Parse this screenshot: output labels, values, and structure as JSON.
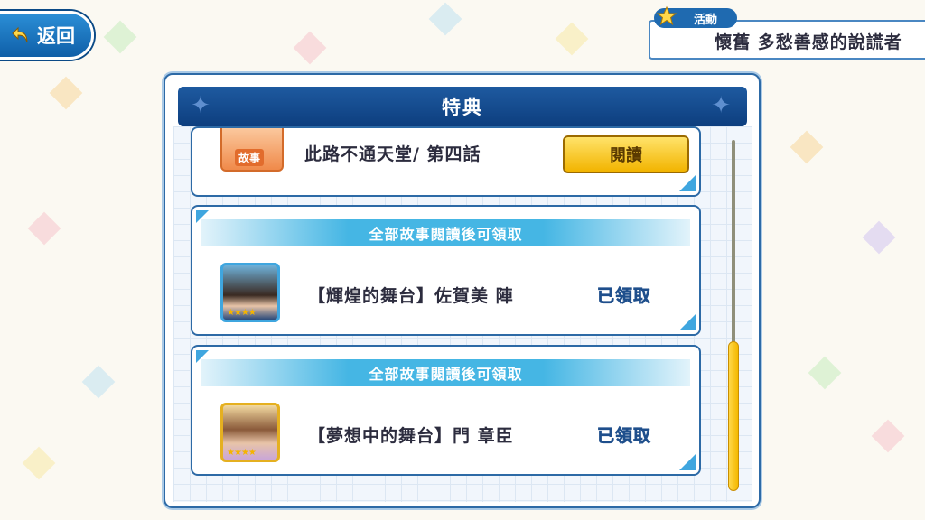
{
  "back_button": {
    "label": "返回",
    "icon": "back-arrow-icon"
  },
  "event": {
    "tag": "活動",
    "title": "懷舊 多愁善感的說謊者"
  },
  "panel": {
    "title": "特典",
    "story_item": {
      "icon_label": "故事",
      "title": "此路不通天堂/ 第四話",
      "button_label": "閱讀"
    },
    "rewards": [
      {
        "banner": "全部故事閱讀後可領取",
        "name": "【輝煌的舞台】佐賀美 陣",
        "status": "已領取",
        "stars": "★★★★"
      },
      {
        "banner": "全部故事閱讀後可領取",
        "name": "【夢想中的舞台】門 章臣",
        "status": "已領取",
        "stars": "★★★★"
      }
    ]
  },
  "colors": {
    "primary": "#1e5aa0",
    "accent": "#45b6e4",
    "button": "#f2b400"
  }
}
